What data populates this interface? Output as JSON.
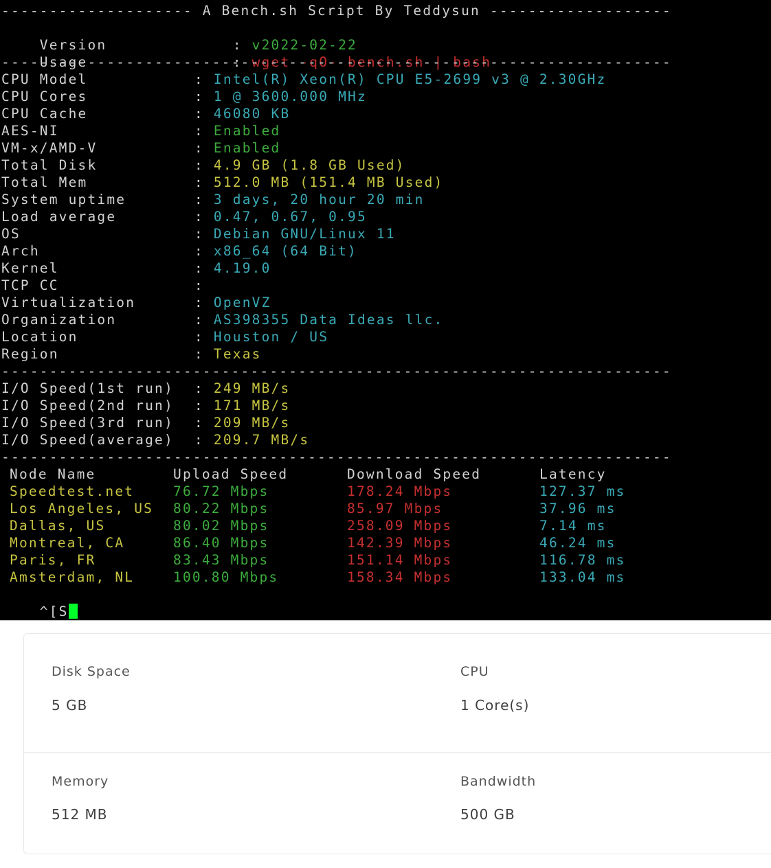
{
  "terminal": {
    "banner": "-------------------- A Bench.sh Script By Teddysun -------------------",
    "divider": "----------------------------------------------------------------------",
    "version": {
      "label": "Version",
      "value": "v2022-02-22"
    },
    "usage": {
      "label": "Usage",
      "value": "wget -qO- bench.sh | bash"
    },
    "system_info": [
      {
        "label": "CPU Model",
        "value": "Intel(R) Xeon(R) CPU E5-2699 v3 @ 2.30GHz",
        "color": "cyan"
      },
      {
        "label": "CPU Cores",
        "value": "1 @ 3600.000 MHz",
        "color": "cyan"
      },
      {
        "label": "CPU Cache",
        "value": "46080 KB",
        "color": "cyan"
      },
      {
        "label": "AES-NI",
        "value": "Enabled",
        "color": "green"
      },
      {
        "label": "VM-x/AMD-V",
        "value": "Enabled",
        "color": "green"
      },
      {
        "label": "Total Disk",
        "value": "4.9 GB (1.8 GB Used)",
        "color": "yellow"
      },
      {
        "label": "Total Mem",
        "value": "512.0 MB (151.4 MB Used)",
        "color": "yellow"
      },
      {
        "label": "System uptime",
        "value": "3 days, 20 hour 20 min",
        "color": "cyan"
      },
      {
        "label": "Load average",
        "value": "0.47, 0.67, 0.95",
        "color": "cyan"
      },
      {
        "label": "OS",
        "value": "Debian GNU/Linux 11",
        "color": "cyan"
      },
      {
        "label": "Arch",
        "value": "x86_64 (64 Bit)",
        "color": "cyan"
      },
      {
        "label": "Kernel",
        "value": "4.19.0",
        "color": "cyan"
      },
      {
        "label": "TCP CC",
        "value": "",
        "color": "cyan"
      },
      {
        "label": "Virtualization",
        "value": "OpenVZ",
        "color": "cyan"
      },
      {
        "label": "Organization",
        "value": "AS398355 Data Ideas llc.",
        "color": "cyan"
      },
      {
        "label": "Location",
        "value": "Houston / US",
        "color": "cyan"
      },
      {
        "label": "Region",
        "value": "Texas",
        "color": "yellow"
      }
    ],
    "io_speed": [
      {
        "label": "I/O Speed(1st run)",
        "value": "249 MB/s"
      },
      {
        "label": "I/O Speed(2nd run)",
        "value": "171 MB/s"
      },
      {
        "label": "I/O Speed(3rd run)",
        "value": "209 MB/s"
      },
      {
        "label": "I/O Speed(average)",
        "value": "209.7 MB/s"
      }
    ],
    "speedtest": {
      "headers": [
        "Node Name",
        "Upload Speed",
        "Download Speed",
        "Latency"
      ],
      "rows": [
        {
          "node": "Speedtest.net",
          "upload": "76.72 Mbps",
          "download": "178.24 Mbps",
          "latency": "127.37 ms"
        },
        {
          "node": "Los Angeles, US",
          "upload": "80.22 Mbps",
          "download": "85.97 Mbps",
          "latency": "37.96 ms"
        },
        {
          "node": "Dallas, US",
          "upload": "80.02 Mbps",
          "download": "258.09 Mbps",
          "latency": "7.14 ms"
        },
        {
          "node": "Montreal, CA",
          "upload": "86.40 Mbps",
          "download": "142.39 Mbps",
          "latency": "46.24 ms"
        },
        {
          "node": "Paris, FR",
          "upload": "83.43 Mbps",
          "download": "151.14 Mbps",
          "latency": "116.78 ms"
        },
        {
          "node": "Amsterdam, NL",
          "upload": "100.80 Mbps",
          "download": "158.34 Mbps",
          "latency": "133.04 ms"
        }
      ]
    },
    "prompt": "^[S"
  },
  "specs": {
    "disk": {
      "label": "Disk Space",
      "value": "5 GB"
    },
    "cpu": {
      "label": "CPU",
      "value": "1 Core(s)"
    },
    "memory": {
      "label": "Memory",
      "value": "512 MB"
    },
    "bandwidth": {
      "label": "Bandwidth",
      "value": "500 GB"
    }
  },
  "colors": {
    "gray": "#d2d2d2",
    "green": "#3dac3d",
    "red": "#c63030",
    "cyan": "#3aa9b6",
    "yellow": "#c7c442",
    "cursor": "#00ff2a"
  }
}
